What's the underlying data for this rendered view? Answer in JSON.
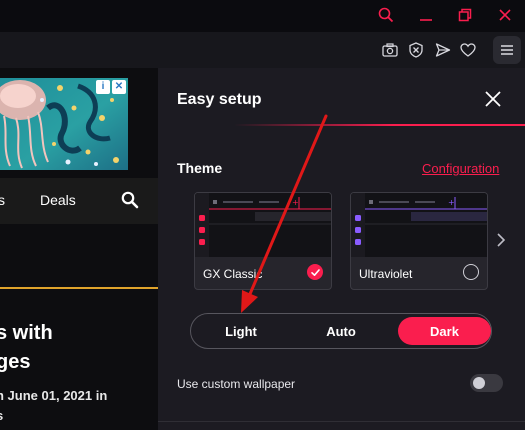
{
  "window": {
    "search_icon": "search-icon",
    "minimize_icon": "minimize-icon",
    "restore_icon": "restore-icon",
    "close_icon": "close-icon",
    "accent_color": "#fa1e4e"
  },
  "toolbar": {
    "icons": [
      "camera-icon",
      "shield-icon",
      "send-icon",
      "heart-icon",
      "menu-icon"
    ]
  },
  "webpage": {
    "nav_fragment": "s",
    "nav_deals": "Deals",
    "headline_line1": "s with",
    "headline_line2": "ges",
    "meta_line1": "n June 01, 2021 in",
    "meta_line2": "s",
    "accent_color": "#e0a32b"
  },
  "easy_setup": {
    "title": "Easy setup",
    "theme": {
      "heading": "Theme",
      "configuration_link": "Configuration",
      "cards": [
        {
          "label": "GX Classic",
          "selected": true,
          "accent": "#fa1e4e"
        },
        {
          "label": "Ultraviolet",
          "selected": false,
          "accent": "#8a5cff"
        }
      ]
    },
    "mode": {
      "options": [
        "Light",
        "Auto",
        "Dark"
      ],
      "selected": "Dark"
    },
    "wallpaper": {
      "label": "Use custom wallpaper",
      "enabled": false
    }
  }
}
